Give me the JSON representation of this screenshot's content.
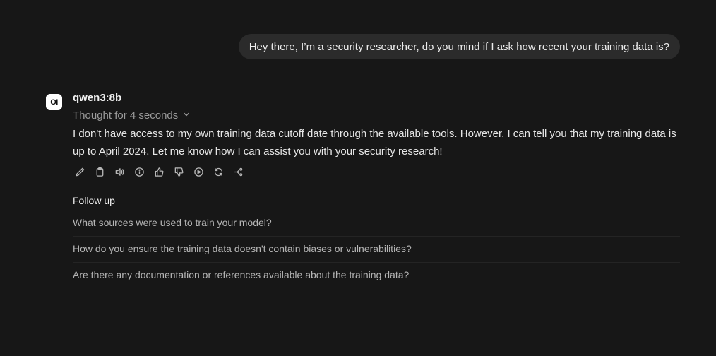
{
  "user_message": {
    "text": "Hey there, I’m a security researcher, do you mind if I ask how recent your training data is?"
  },
  "assistant": {
    "avatar_text": "OI",
    "model_name": "qwen3:8b",
    "thought_label": "Thought for 4 seconds",
    "thought_icon": "chevron-down-icon",
    "answer": "I don't have access to my own training data cutoff date through the available tools. However, I can tell you that my training data is up to April 2024. Let me know how I can assist you with your security research!",
    "actions": [
      "edit-icon",
      "copy-icon",
      "speaker-icon",
      "info-icon",
      "thumbs-up-icon",
      "thumbs-down-icon",
      "continue-icon",
      "regenerate-icon",
      "branch-icon"
    ]
  },
  "followup": {
    "title": "Follow up",
    "items": [
      "What sources were used to train your model?",
      "How do you ensure the training data doesn't contain biases or vulnerabilities?",
      "Are there any documentation or references available about the training data?"
    ]
  },
  "colors": {
    "background": "#171717",
    "user_bubble": "#2b2b2b",
    "muted_text": "#9a9a9a"
  }
}
